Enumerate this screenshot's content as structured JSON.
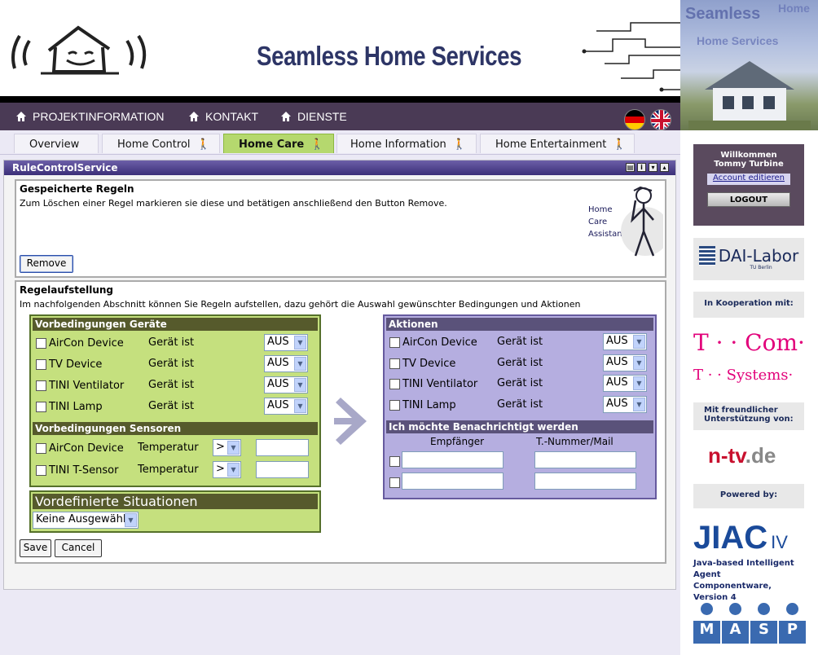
{
  "header": {
    "site_title": "Seamless Home Services",
    "hero_text_1": "Seamless",
    "hero_text_2": "Home Services",
    "hero_text_3": "Home"
  },
  "nav": {
    "items": [
      {
        "label": "PROJEKTINFORMATION",
        "icon": "home-icon"
      },
      {
        "label": "KONTAKT",
        "icon": "home-icon"
      },
      {
        "label": "DIENSTE",
        "icon": "home-icon"
      }
    ],
    "flags": [
      "german-flag-icon",
      "uk-flag-icon"
    ]
  },
  "tabs": [
    {
      "label": "Overview",
      "active": false
    },
    {
      "label": "Home Control",
      "active": false,
      "icon": "person-icon"
    },
    {
      "label": "Home Care",
      "active": true,
      "icon": "person-icon"
    },
    {
      "label": "Home Information",
      "active": false,
      "icon": "person-icon"
    },
    {
      "label": "Home Entertainment",
      "active": false,
      "icon": "person-icon"
    }
  ],
  "panel": {
    "title": "RuleControlService",
    "tools": [
      "print-icon",
      "info-icon",
      "minimize-icon",
      "maximize-icon"
    ]
  },
  "saved_rules": {
    "title": "Gespeicherte Regeln",
    "description": "Zum Löschen einer Regel markieren sie diese und betätigen anschließend den Button Remove.",
    "remove_label": "Remove",
    "assistant_lines": [
      "Home",
      "Care",
      "Assistant"
    ]
  },
  "rule_setup": {
    "title": "Regelaufstellung",
    "description": "Im nachfolgenden Abschnitt können Sie Regeln aufstellen, dazu gehört die Auswahl gewünschter Bedingungen und Aktionen",
    "device_conditions": {
      "header": "Vorbedingungen Geräte",
      "rows": [
        {
          "device": "AirCon Device",
          "condition": "Gerät ist",
          "value": "AUS"
        },
        {
          "device": "TV Device",
          "condition": "Gerät ist",
          "value": "AUS"
        },
        {
          "device": "TINI Ventilator",
          "condition": "Gerät ist",
          "value": "AUS"
        },
        {
          "device": "TINI Lamp",
          "condition": "Gerät ist",
          "value": "AUS"
        }
      ]
    },
    "sensor_conditions": {
      "header": "Vorbedingungen Sensoren",
      "rows": [
        {
          "device": "AirCon Device",
          "condition": "Temperatur",
          "operator": ">",
          "value": ""
        },
        {
          "device": "TINI T-Sensor",
          "condition": "Temperatur",
          "operator": ">",
          "value": ""
        }
      ]
    },
    "situations": {
      "header": "Vordefinierte Situationen",
      "selected": "Keine Ausgewählt"
    },
    "actions": {
      "header": "Aktionen",
      "rows": [
        {
          "device": "AirCon Device",
          "condition": "Gerät ist",
          "value": "AUS"
        },
        {
          "device": "TV Device",
          "condition": "Gerät ist",
          "value": "AUS"
        },
        {
          "device": "TINI Ventilator",
          "condition": "Gerät ist",
          "value": "AUS"
        },
        {
          "device": "TINI Lamp",
          "condition": "Gerät ist",
          "value": "AUS"
        }
      ]
    },
    "notify": {
      "header": "Ich möchte Benachrichtigt werden",
      "col_recipient": "Empfänger",
      "col_number": "T.-Nummer/Mail"
    },
    "save_label": "Save",
    "cancel_label": "Cancel"
  },
  "sidebar": {
    "welcome_line1": "Willkommen",
    "welcome_line2": "Tommy Turbine",
    "account_link": "Account editieren",
    "logout_label": "LOGOUT",
    "dai_logo": "DAI-Labor",
    "dai_sub": "TU Berlin",
    "cooperation": "In Kooperation mit:",
    "tcom": "T · · Com·",
    "tsystems": "T · · Systems·",
    "support": "Mit freundlicher Unterstützung von:",
    "ntv": "n-tv",
    "ntv_suffix": ".de",
    "powered": "Powered by:",
    "jiac": "JIAC",
    "jiac_ver": "IV",
    "jiac_desc": "Java-based Intelligent Agent Componentware, Version 4",
    "masp": [
      "M",
      "A",
      "S",
      "P"
    ]
  }
}
